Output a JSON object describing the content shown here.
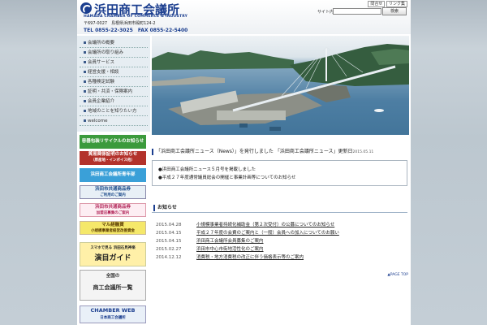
{
  "header": {
    "title": "浜田商工会議所",
    "subtitle": "HAMADA CHAMBER OF COMMERCE & INDUSTRY",
    "address": "〒697-0027　島根県浜田市殿町124-2",
    "tel": "TEL 0855-22-3025　FAX 0855-22-5400",
    "links": [
      "問合せ",
      "リンク集"
    ],
    "search_label": "サイト内検索",
    "search_placeholder": "",
    "search_button": "検索"
  },
  "nav": {
    "items": [
      "会議所の概要",
      "会議所の取り組み",
      "会員サービス",
      "経営支援・相談",
      "各種検定試験",
      "証明・共済・保険案内",
      "会員企業紹介",
      "地域のことを知りたい方",
      "welcome"
    ]
  },
  "banners": [
    {
      "line1": "容器包装リサイクルのお知らせ",
      "line2": ""
    },
    {
      "line1": "貿易関係証明のお知らせ",
      "line2": "（原産地・インボイス他）"
    },
    {
      "line1": "浜田商工会議所青年部",
      "line2": ""
    },
    {
      "line1": "浜田市共通商品券",
      "line2": "ご利用のご案内"
    },
    {
      "line1": "浜田市共通商品券",
      "line2": "加盟店募集のご案内"
    },
    {
      "line1": "マル経融資",
      "line2": "小規模事業者経営改善資金"
    },
    {
      "line1": "スマホで見る 浜田石見神楽",
      "line2": "演目ガイド"
    },
    {
      "line1": "全国の",
      "line2": "商工会議所一覧"
    },
    {
      "line1": "CHAMBER WEB",
      "line2": "日本商工会議所"
    }
  ],
  "news": {
    "heading": "「浜田商工会議所ニュース（News）」を発行しました 「浜田商工会議所ニュース」更新日",
    "updated": "2015.05.11",
    "lines": [
      "●浜田商工会議所ニュース５月号を掲載しました",
      "●平成２７年度通常議員総会の開催と事業計画等についてのお知らせ"
    ]
  },
  "info": {
    "heading": "お知らせ",
    "items": [
      {
        "date": "2015.04.28",
        "text": "小規模事業者持続化補助金（第２次受付）の公募についてのお知らせ"
      },
      {
        "date": "2015.04.15",
        "text": "平成２７年度の会費のご案内と（一般）会員への加入についてのお願い"
      },
      {
        "date": "2015.04.15",
        "text": "浜田商工会議所会員募集のご案内"
      },
      {
        "date": "2015.02.27",
        "text": "浜田市中心市街地活性化のご案内"
      },
      {
        "date": "2014.12.12",
        "text": "消費税・地方消費税の改正に伴う価格表示等のご案内"
      }
    ],
    "page_top": "▲PAGE TOP"
  }
}
